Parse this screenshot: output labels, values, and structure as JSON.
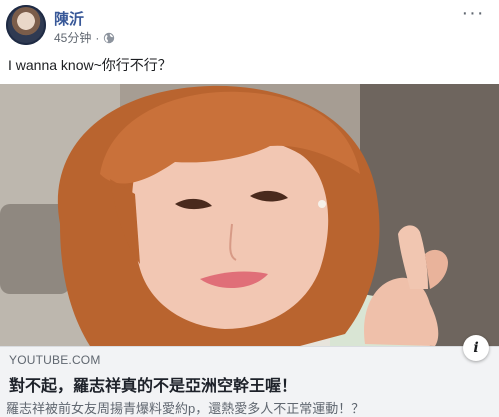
{
  "post": {
    "author": "陳沂",
    "timestamp": "45分钟",
    "separator": "·",
    "privacy_icon": "globe-icon",
    "more_icon": "more-dots-icon",
    "more_label": "···",
    "message": "I wanna know~你行不行？"
  },
  "link_preview": {
    "domain": "YOUTUBE.COM",
    "title": "對不起，羅志祥真的不是亞洲空幹王喔！",
    "description": "羅志祥被前女友周揚青爆料愛約p，還熱愛多人不正常運動！？",
    "info_icon": "info-icon",
    "info_label": "i"
  },
  "colors": {
    "author_link": "#385898",
    "meta_text": "#606770",
    "preview_bg": "#f2f3f5"
  }
}
